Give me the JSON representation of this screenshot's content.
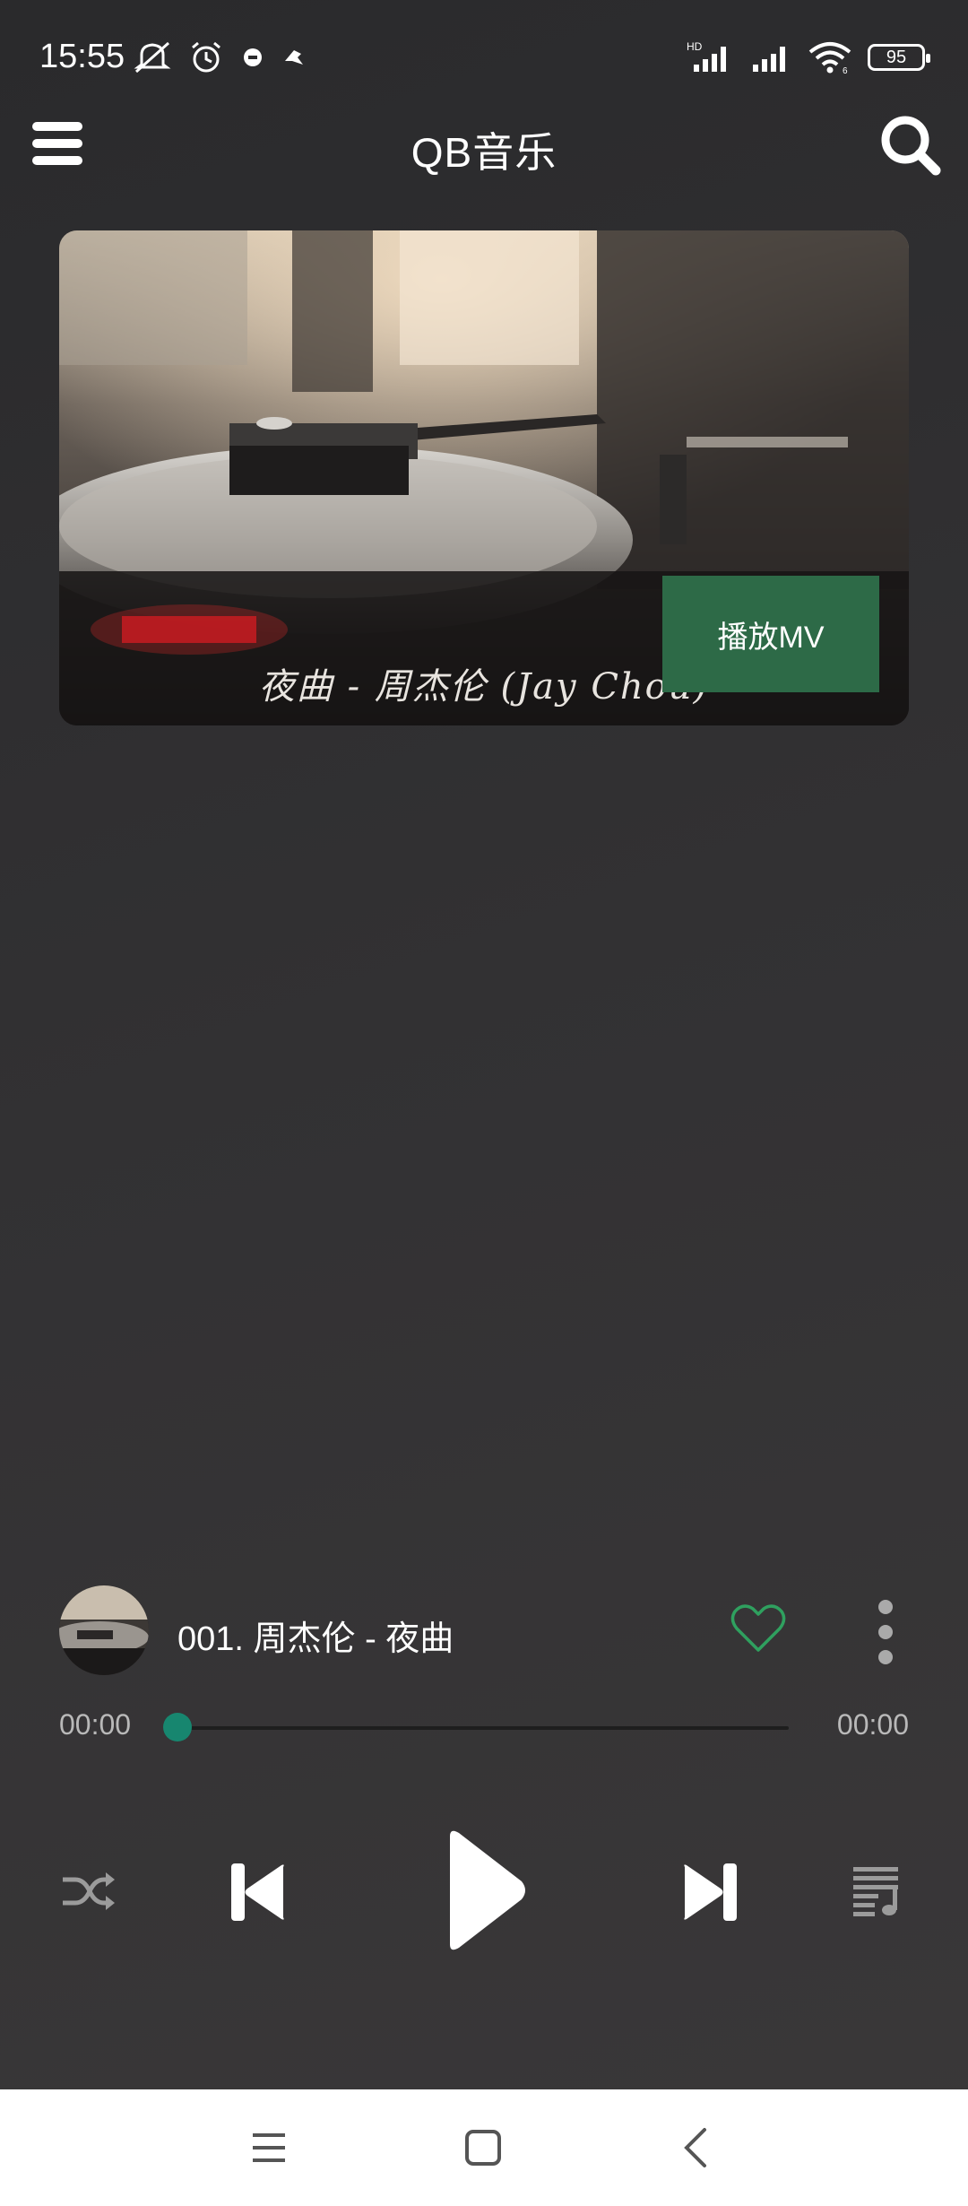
{
  "status_bar": {
    "time": "15:55",
    "battery": "95",
    "network_label": "HD"
  },
  "app_bar": {
    "title": "QB音乐",
    "menu_icon": "hamburger-menu-icon",
    "search_icon": "search-icon"
  },
  "mv_card": {
    "caption": "夜曲 - 周杰伦 (Jay Chou)",
    "play_button_label": "播放MV"
  },
  "now_playing": {
    "title": "001. 周杰伦 - 夜曲",
    "favorite_icon": "heart-outline-icon",
    "more_icon": "more-vertical-icon",
    "accent_color": "#2fa05f"
  },
  "progress": {
    "current_time": "00:00",
    "total_time": "00:00",
    "fraction": 0,
    "thumb_color": "#17866f"
  },
  "controls": {
    "shuffle_icon": "shuffle-icon",
    "previous_icon": "skip-previous-icon",
    "play_icon": "play-icon",
    "next_icon": "skip-next-icon",
    "playlist_icon": "playlist-icon"
  },
  "nav_bar": {
    "recents_icon": "recents-icon",
    "home_icon": "home-icon",
    "back_icon": "back-icon"
  }
}
